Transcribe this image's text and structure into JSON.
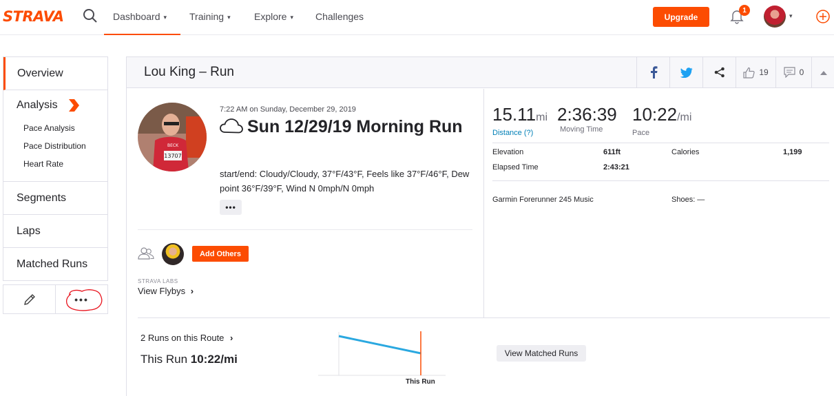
{
  "nav": {
    "logo": "STRAVA",
    "items": [
      {
        "label": "Dashboard",
        "has_chevron": true,
        "active": true
      },
      {
        "label": "Training",
        "has_chevron": true
      },
      {
        "label": "Explore",
        "has_chevron": true
      },
      {
        "label": "Challenges",
        "has_chevron": false
      }
    ],
    "upgrade_label": "Upgrade",
    "notification_count": "1",
    "chevron": "⌄"
  },
  "sidebar": {
    "overview": "Overview",
    "analysis": "Analysis",
    "analysis_sub": [
      "Pace Analysis",
      "Pace Distribution",
      "Heart Rate"
    ],
    "segments": "Segments",
    "laps": "Laps",
    "matched_runs": "Matched Runs",
    "more_label": "•••"
  },
  "header": {
    "title": "Lou King – Run",
    "likes": "19",
    "comments": "0",
    "icons": [
      "facebook-icon",
      "twitter-icon",
      "share-icon",
      "thumbs-up-icon",
      "comment-icon",
      "collapse-icon"
    ]
  },
  "activity": {
    "time": "7:22 AM on Sunday, December 29, 2019",
    "title": "Sun 12/29/19 Morning Run",
    "weather": "start/end: Cloudy/Cloudy, 37°F/43°F, Feels like 37°F/46°F, Dew point 36°F/39°F, Wind N 0mph/N 0mph",
    "more_label": "•••",
    "add_others": "Add Others",
    "labs": "STRAVA LABS",
    "flybys": "View Flybys"
  },
  "stats": {
    "distance": {
      "value": "15.11",
      "unit": "mi",
      "label": "Distance (?)"
    },
    "moving_time": {
      "value": "2:36:39",
      "label": "Moving Time"
    },
    "pace": {
      "value": "10:22",
      "unit": "/mi",
      "label": "Pace"
    },
    "elevation_label": "Elevation",
    "elevation_value": "611ft",
    "calories_label": "Calories",
    "calories_value": "1,199",
    "elapsed_label": "Elapsed Time",
    "elapsed_value": "2:43:21",
    "device": "Garmin Forerunner 245 Music",
    "shoes": "Shoes: —"
  },
  "route": {
    "link": "2 Runs on this Route",
    "this_run_prefix": "This Run",
    "this_run_pace": "10:22/mi",
    "chart_label": "This Run",
    "matched_button": "View Matched Runs"
  },
  "colors": {
    "brand": "#fc4c02",
    "link": "#007fb6",
    "chart_line": "#2aa8e0",
    "annotation": "#e8141e"
  }
}
